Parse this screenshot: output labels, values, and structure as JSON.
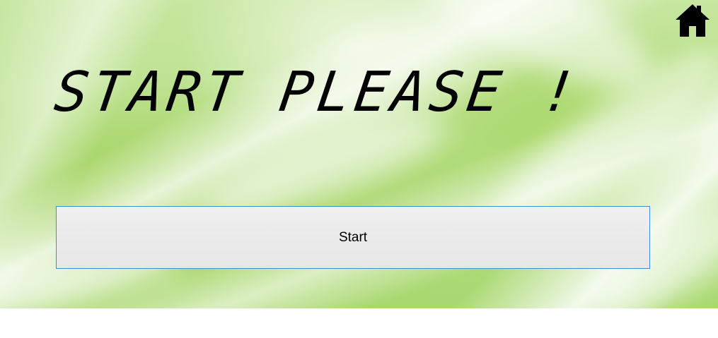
{
  "screen": {
    "heading": "START PLEASE !",
    "start_button_label": "Start",
    "home_icon": "home-icon"
  },
  "colors": {
    "background_accent": "#a8d870",
    "button_border": "#3b8ee0",
    "button_bg": "#e6e6e6",
    "text": "#000000"
  }
}
